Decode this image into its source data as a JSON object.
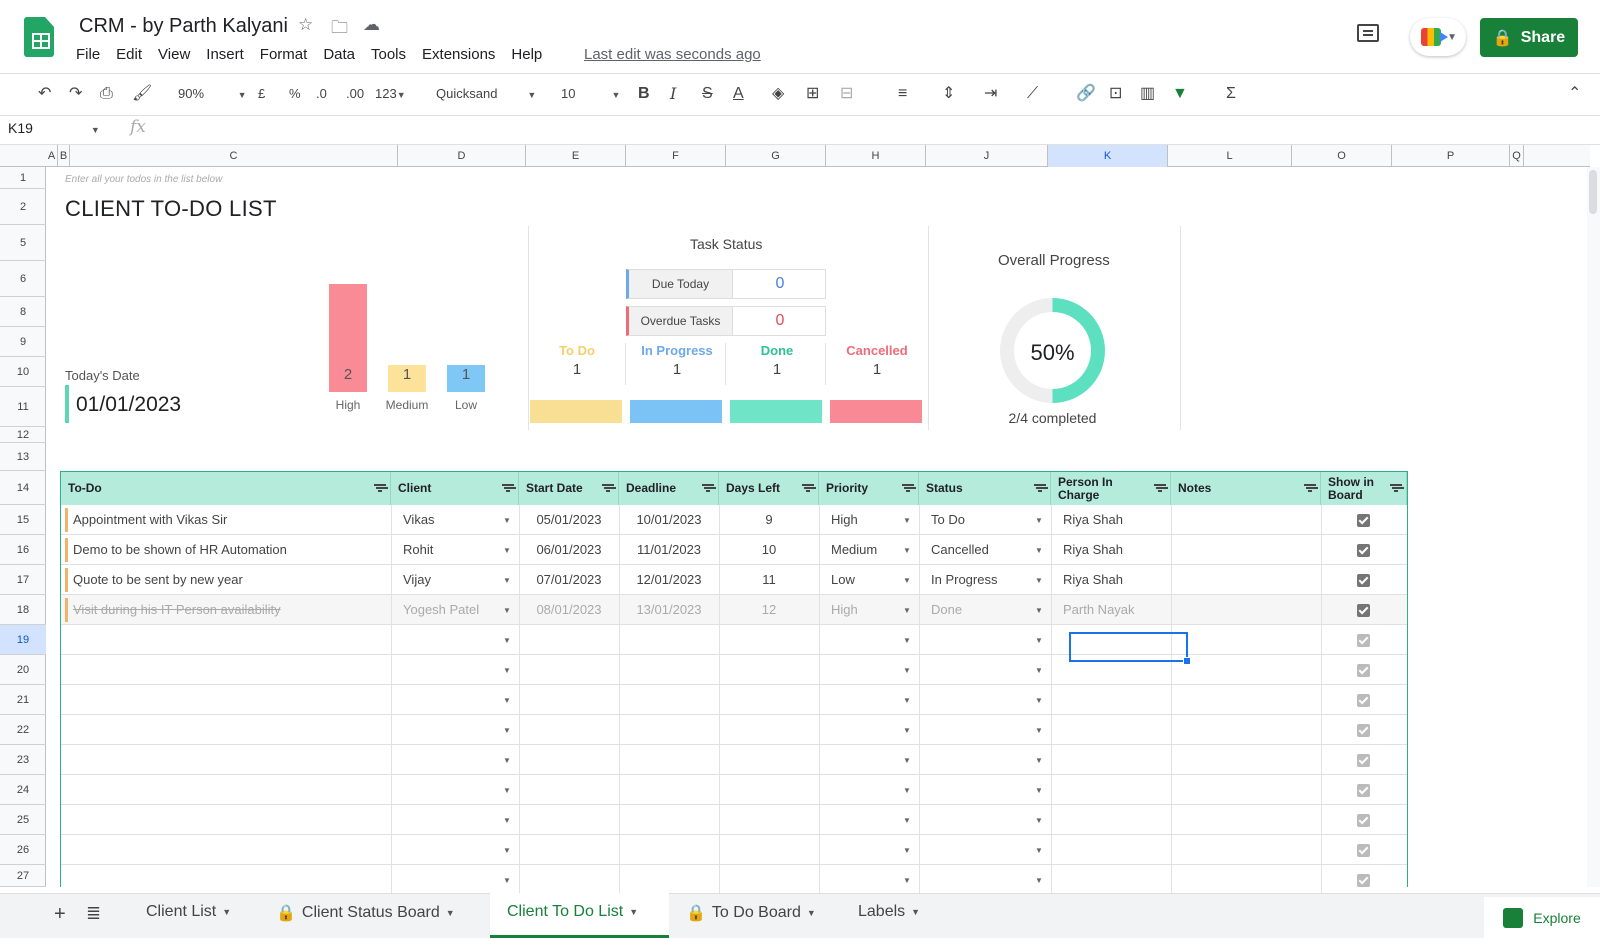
{
  "app": {
    "doc_title": "CRM - by Parth Kalyani",
    "menu": [
      "File",
      "Edit",
      "View",
      "Insert",
      "Format",
      "Data",
      "Tools",
      "Extensions",
      "Help"
    ],
    "last_edit": "Last edit was seconds ago",
    "share_label": "Share"
  },
  "toolbar": {
    "zoom": "90%",
    "currency": "£",
    "percent": "%",
    "dec_less": ".0",
    "dec_more": ".00",
    "format_123": "123",
    "font": "Quicksand",
    "font_size": "10",
    "bold": "B",
    "italic": "I",
    "strike": "S",
    "text_color": "A",
    "sigma": "Σ"
  },
  "formula_bar": {
    "name_box": "K19",
    "fx": "fx"
  },
  "columns": [
    "A",
    "B",
    "C",
    "D",
    "E",
    "F",
    "G",
    "H",
    "J",
    "K",
    "L",
    "O",
    "P",
    "Q"
  ],
  "rows": [
    "1",
    "2",
    "5",
    "6",
    "8",
    "9",
    "10",
    "11",
    "12",
    "13",
    "14",
    "15",
    "16",
    "17",
    "18",
    "19",
    "20",
    "21",
    "22",
    "23",
    "24",
    "25",
    "26",
    "27"
  ],
  "dashboard": {
    "hint": "Enter all your todos in the list below",
    "title": "CLIENT TO-DO LIST",
    "today_label": "Today's Date",
    "today_value": "01/01/2023",
    "priority": [
      {
        "label": "High",
        "value": 2,
        "color": "#f98b96"
      },
      {
        "label": "Medium",
        "value": 1,
        "color": "#fde29a"
      },
      {
        "label": "Low",
        "value": 1,
        "color": "#7fc7f5"
      }
    ],
    "task_status": {
      "title": "Task Status",
      "due_today_label": "Due Today",
      "due_today": "0",
      "overdue_label": "Overdue Tasks",
      "overdue": "0"
    },
    "statuses": [
      {
        "label": "To Do",
        "count": "1",
        "color": "#f6cf6b",
        "bar": "#f9df94"
      },
      {
        "label": "In Progress",
        "count": "1",
        "color": "#6fa8e8",
        "bar": "#7cc3f5"
      },
      {
        "label": "Done",
        "count": "1",
        "color": "#2fbf97",
        "bar": "#6fe4c6"
      },
      {
        "label": "Cancelled",
        "count": "1",
        "color": "#f06b7a",
        "bar": "#f98995"
      }
    ],
    "progress": {
      "title": "Overall Progress",
      "percent": "50%",
      "fraction": 0.5,
      "subtitle": "2/4 completed"
    }
  },
  "table": {
    "headers": [
      "To-Do",
      "Client",
      "Start Date",
      "Deadline",
      "Days Left",
      "Priority",
      "Status",
      "Person In Charge",
      "Notes",
      "Show in Board"
    ],
    "rows": [
      {
        "todo": "Appointment with Vikas Sir",
        "client": "Vikas",
        "start": "05/01/2023",
        "deadline": "10/01/2023",
        "days": "9",
        "priority": "High",
        "status": "To Do",
        "person": "Riya Shah",
        "notes": "",
        "show": true,
        "done": false
      },
      {
        "todo": "Demo to be shown of HR Automation",
        "client": "Rohit",
        "start": "06/01/2023",
        "deadline": "11/01/2023",
        "days": "10",
        "priority": "Medium",
        "status": "Cancelled",
        "person": "Riya Shah",
        "notes": "",
        "show": true,
        "done": false
      },
      {
        "todo": "Quote to be sent by new year",
        "client": "Vijay",
        "start": "07/01/2023",
        "deadline": "12/01/2023",
        "days": "11",
        "priority": "Low",
        "status": "In Progress",
        "person": "Riya Shah",
        "notes": "",
        "show": true,
        "done": false
      },
      {
        "todo": "Visit during his IT Person availability",
        "client": "Yogesh Patel",
        "start": "08/01/2023",
        "deadline": "13/01/2023",
        "days": "12",
        "priority": "High",
        "status": "Done",
        "person": "Parth Nayak",
        "notes": "",
        "show": true,
        "done": true
      }
    ]
  },
  "tabs": [
    "Client List",
    "Client Status Board",
    "Client To Do List",
    "To Do Board",
    "Labels"
  ],
  "explore_label": "Explore"
}
